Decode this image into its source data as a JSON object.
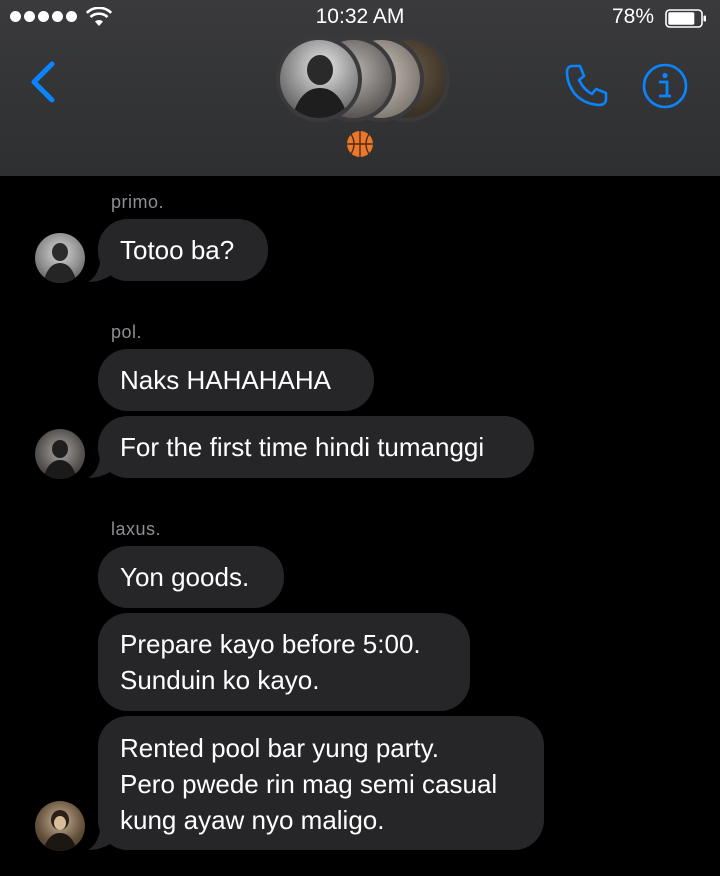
{
  "status_bar": {
    "time": "10:32 AM",
    "battery_percent": "78%",
    "signal_bars": 5
  },
  "header": {
    "group_emoji": "🏀",
    "accent_color": "#0a84ff"
  },
  "messages": [
    {
      "sender": "primo.",
      "texts": [
        "Totoo ba?"
      ]
    },
    {
      "sender": "pol.",
      "texts": [
        "Naks HAHAHAHA",
        "For the first time hindi tumanggi"
      ]
    },
    {
      "sender": "laxus.",
      "texts": [
        "Yon goods.",
        "Prepare kayo before 5:00.\nSunduin ko kayo.",
        "Rented pool bar yung party.\nPero pwede rin mag semi casual\nkung ayaw nyo maligo."
      ]
    }
  ]
}
